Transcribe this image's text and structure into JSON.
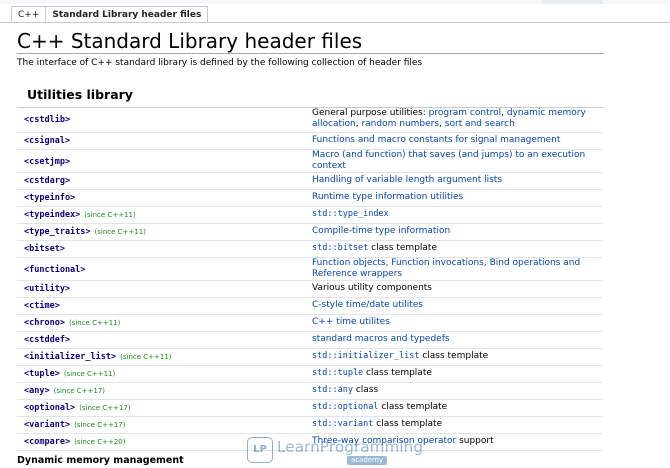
{
  "breadcrumb": {
    "language": "C++",
    "current": "Standard Library header files"
  },
  "page": {
    "title": "C++ Standard Library header files",
    "intro": "The interface of C++ standard library is defined by the following collection of header files",
    "section_title": "Utilities library",
    "next_section_title": "Dynamic memory management"
  },
  "rows": [
    {
      "header": "<cstdlib>",
      "since": "",
      "desc": [
        {
          "t": "General purpose utilities: ",
          "k": "text"
        },
        {
          "t": "program control",
          "k": "link"
        },
        {
          "t": ", ",
          "k": "text"
        },
        {
          "t": "dynamic memory allocation",
          "k": "link"
        },
        {
          "t": ", ",
          "k": "text"
        },
        {
          "t": "random numbers",
          "k": "link"
        },
        {
          "t": ", ",
          "k": "text"
        },
        {
          "t": "sort and search",
          "k": "link"
        }
      ]
    },
    {
      "header": "<csignal>",
      "since": "",
      "desc": [
        {
          "t": "Functions and macro constants for signal management",
          "k": "link"
        }
      ]
    },
    {
      "header": "<csetjmp>",
      "since": "",
      "desc": [
        {
          "t": "Macro (and function) that saves (and jumps) to an execution context",
          "k": "link"
        }
      ]
    },
    {
      "header": "<cstdarg>",
      "since": "",
      "desc": [
        {
          "t": "Handling of variable length argument lists",
          "k": "link"
        }
      ]
    },
    {
      "header": "<typeinfo>",
      "since": "",
      "desc": [
        {
          "t": "Runtime type information utilities",
          "k": "link"
        }
      ]
    },
    {
      "header": "<typeindex>",
      "since": "(since C++11)",
      "desc": [
        {
          "t": "std::type_index",
          "k": "mono"
        }
      ]
    },
    {
      "header": "<type_traits>",
      "since": "(since C++11)",
      "desc": [
        {
          "t": "Compile-time type information",
          "k": "link"
        }
      ]
    },
    {
      "header": "<bitset>",
      "since": "",
      "desc": [
        {
          "t": "std::bitset",
          "k": "mono"
        },
        {
          "t": " class template",
          "k": "text"
        }
      ]
    },
    {
      "header": "<functional>",
      "since": "",
      "desc": [
        {
          "t": "Function objects, Function invocations, Bind operations and Reference wrappers",
          "k": "link"
        }
      ]
    },
    {
      "header": "<utility>",
      "since": "",
      "desc": [
        {
          "t": "Various utility components",
          "k": "text"
        }
      ]
    },
    {
      "header": "<ctime>",
      "since": "",
      "desc": [
        {
          "t": "C-style time/date utilites",
          "k": "link"
        }
      ]
    },
    {
      "header": "<chrono>",
      "since": "(since C++11)",
      "desc": [
        {
          "t": "C++ time utilites",
          "k": "link"
        }
      ]
    },
    {
      "header": "<cstddef>",
      "since": "",
      "desc": [
        {
          "t": "standard macros and typedefs",
          "k": "link"
        }
      ]
    },
    {
      "header": "<initializer_list>",
      "since": "(since C++11)",
      "desc": [
        {
          "t": "std::initializer_list",
          "k": "mono"
        },
        {
          "t": " class template",
          "k": "text"
        }
      ]
    },
    {
      "header": "<tuple>",
      "since": "(since C++11)",
      "desc": [
        {
          "t": "std::tuple",
          "k": "mono"
        },
        {
          "t": " class template",
          "k": "text"
        }
      ]
    },
    {
      "header": "<any>",
      "since": "(since C++17)",
      "desc": [
        {
          "t": "std::any",
          "k": "mono"
        },
        {
          "t": " class",
          "k": "text"
        }
      ]
    },
    {
      "header": "<optional>",
      "since": "(since C++17)",
      "desc": [
        {
          "t": "std::optional",
          "k": "mono"
        },
        {
          "t": " class template",
          "k": "text"
        }
      ]
    },
    {
      "header": "<variant>",
      "since": "(since C++17)",
      "desc": [
        {
          "t": "std::variant",
          "k": "mono"
        },
        {
          "t": " class template",
          "k": "text"
        }
      ]
    },
    {
      "header": "<compare>",
      "since": "(since C++20)",
      "desc": [
        {
          "t": "Three-way comparison operator",
          "k": "link"
        },
        {
          "t": " support",
          "k": "text"
        }
      ]
    }
  ],
  "watermark": {
    "badge": "LP",
    "name": "LearnProgramming",
    "sub": "academy"
  },
  "colors": {
    "header_link": "#0b0080",
    "link": "#0645ad",
    "since": "#1c8a1c",
    "border": "#c8ccd1"
  }
}
